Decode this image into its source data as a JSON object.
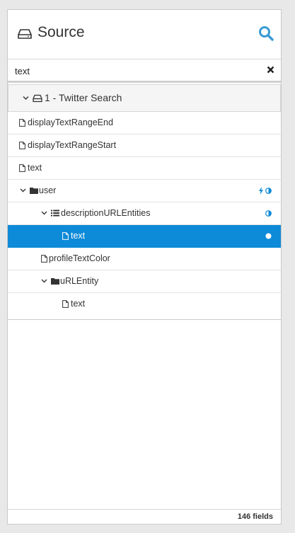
{
  "panel": {
    "title": "Source",
    "icons": {
      "source": "drive-icon",
      "search": "search-icon"
    }
  },
  "filter": {
    "value": "text",
    "clear_icon": "close-icon"
  },
  "tree": {
    "group": {
      "label": "1 - Twitter Search"
    },
    "rows": [
      {
        "label": "displayTextRangeEnd",
        "kind": "field"
      },
      {
        "label": "displayTextRangeStart",
        "kind": "field"
      },
      {
        "label": "text",
        "kind": "field"
      },
      {
        "label": "user",
        "kind": "folder",
        "badges": [
          "bolt-icon",
          "half-circle-icon"
        ]
      },
      {
        "label": "descriptionURLEntities",
        "kind": "list",
        "badges": [
          "half-circle-icon"
        ]
      },
      {
        "label": "text",
        "kind": "field",
        "selected": true,
        "badges": [
          "dot-icon"
        ]
      },
      {
        "label": "profileTextColor",
        "kind": "field"
      },
      {
        "label": "uRLEntity",
        "kind": "folder"
      },
      {
        "label": "text",
        "kind": "field"
      }
    ]
  },
  "footer": {
    "count": "146 fields"
  },
  "colors": {
    "accent": "#0d8ad8",
    "search": "#3a9bd5"
  }
}
